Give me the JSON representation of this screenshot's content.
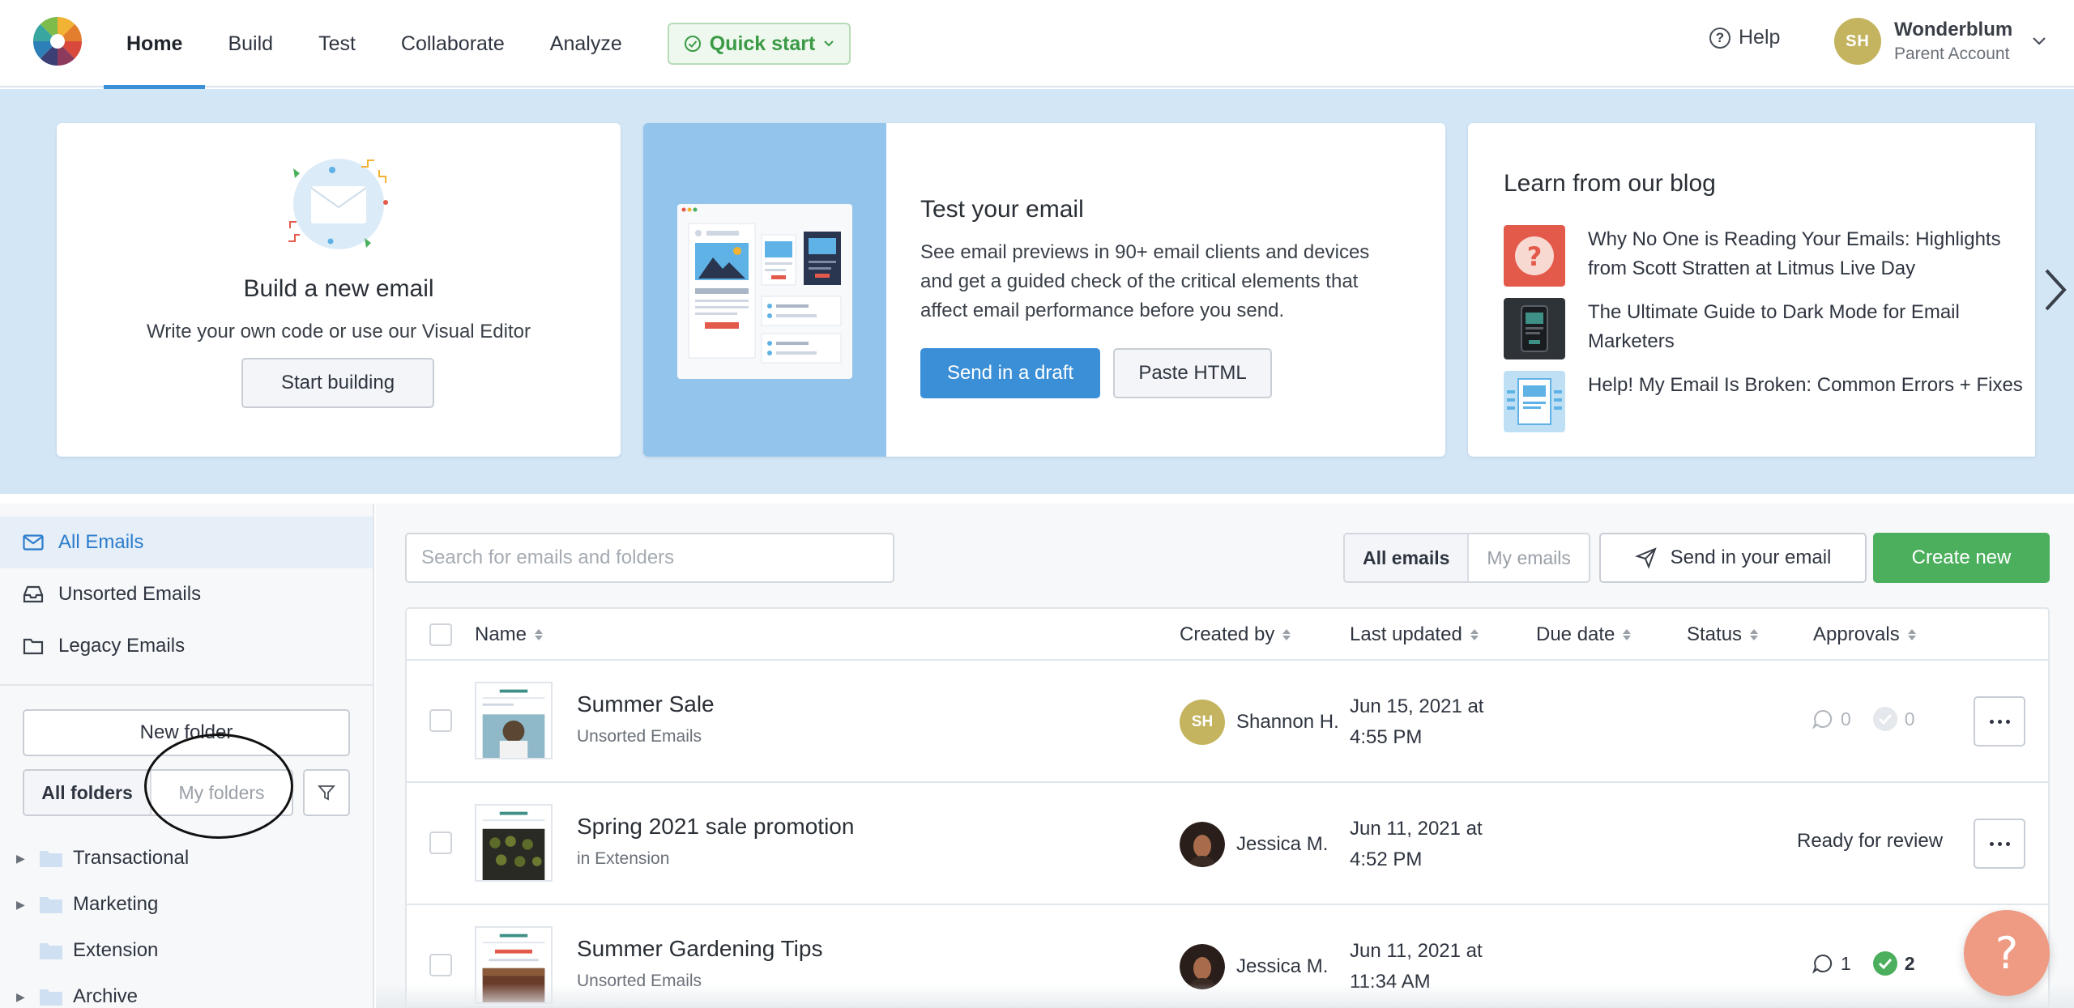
{
  "nav": {
    "items": [
      "Home",
      "Build",
      "Test",
      "Collaborate",
      "Analyze"
    ],
    "quick_start": "Quick start",
    "help": "Help"
  },
  "account": {
    "initials": "SH",
    "name": "Wonderblum",
    "role": "Parent Account"
  },
  "hero": {
    "build": {
      "title": "Build a new email",
      "subtitle": "Write your own code or use our Visual Editor",
      "button": "Start building"
    },
    "test": {
      "title": "Test your email",
      "description": "See email previews in 90+ email clients and devices and get a guided check of the critical elements that affect email performance before you send.",
      "primary_button": "Send in a draft",
      "secondary_button": "Paste HTML"
    },
    "blog": {
      "title": "Learn from our blog",
      "posts": [
        "Why No One is Reading Your Emails: Highlights from Scott Stratten at Litmus Live Day",
        "The Ultimate Guide to Dark Mode for Email Marketers",
        "Help! My Email Is Broken: Common Errors + Fixes"
      ]
    }
  },
  "sidebar": {
    "links": [
      "All Emails",
      "Unsorted Emails",
      "Legacy Emails"
    ],
    "new_folder": "New folder",
    "folder_tabs": [
      "All folders",
      "My folders"
    ],
    "folders": [
      "Transactional",
      "Marketing",
      "Extension",
      "Archive"
    ]
  },
  "toolbar": {
    "search_placeholder": "Search for emails and folders",
    "view_tabs": [
      "All emails",
      "My emails"
    ],
    "send_email": "Send in your email",
    "create_new": "Create new"
  },
  "table": {
    "headers": [
      "Name",
      "Created by",
      "Last updated",
      "Due date",
      "Status",
      "Approvals"
    ],
    "rows": [
      {
        "title": "Summer Sale",
        "folder": "Unsorted Emails",
        "creator": "Shannon H.",
        "creator_initials": "SH",
        "updated_line1": "Jun 15, 2021 at",
        "updated_line2": "4:55 PM",
        "status": "",
        "comments": "0",
        "approvals": "0"
      },
      {
        "title": "Spring 2021 sale promotion",
        "folder": "in Extension",
        "creator": "Jessica M.",
        "updated_line1": "Jun 11, 2021 at",
        "updated_line2": "4:52 PM",
        "status": "Ready for review"
      },
      {
        "title": "Summer Gardening Tips",
        "folder": "Unsorted Emails",
        "creator": "Jessica M.",
        "updated_line1": "Jun 11, 2021 at",
        "updated_line2": "11:34 AM",
        "status": "",
        "comments": "1",
        "approvals": "2"
      }
    ]
  },
  "colors": {
    "accent_blue": "#3b8fd6",
    "create_green": "#4caf5e",
    "hero_bg": "#d3e6f6",
    "help_fab": "#ef9a82"
  },
  "help_fab_label": "?"
}
